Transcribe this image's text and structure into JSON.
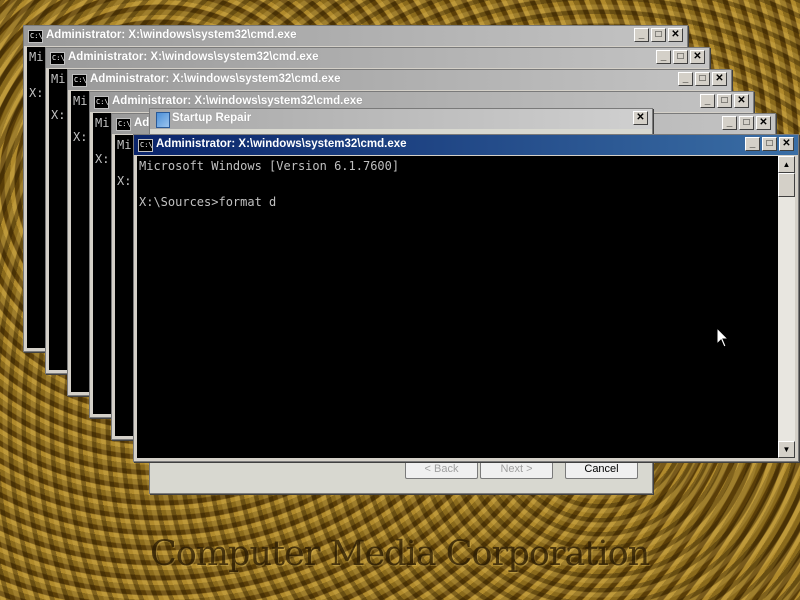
{
  "desktop": {
    "watermark": "Computer Media Corporation"
  },
  "cmd_title": "Administrator: X:\\windows\\system32\\cmd.exe",
  "cmd_icon_text": "C:\\",
  "background_windows": [
    {
      "title": "Administrator: X:\\windows\\system32\\cmd.exe",
      "line1": "Mi",
      "line2": "X:"
    },
    {
      "title": "Administrator: X:\\windows\\system32\\cmd.exe",
      "line1": "Mi",
      "line2": "X:"
    },
    {
      "title": "Administrator: X:\\windows\\system32\\cmd.exe",
      "line1": "Mi",
      "line2": "X:"
    },
    {
      "title": "Administrator: X:\\windows\\system32\\cmd.exe",
      "line1": "Mi",
      "line2": "X:"
    },
    {
      "title": "Ad",
      "line1": "Mi",
      "line2": "X:"
    }
  ],
  "startup_repair": {
    "title": "Startup Repair",
    "back_label": "< Back",
    "next_label": "Next >",
    "cancel_label": "Cancel"
  },
  "active_window": {
    "title": "Administrator: X:\\windows\\system32\\cmd.exe",
    "console_lines": [
      "Microsoft Windows [Version 6.1.7600]",
      "",
      "X:\\Sources>format d"
    ]
  },
  "window_controls": {
    "minimize": "_",
    "maximize": "□",
    "close": "✕"
  },
  "colors": {
    "active_titlebar": "#0a246a",
    "console_bg": "#000000",
    "console_fg": "#c0c0c0"
  }
}
